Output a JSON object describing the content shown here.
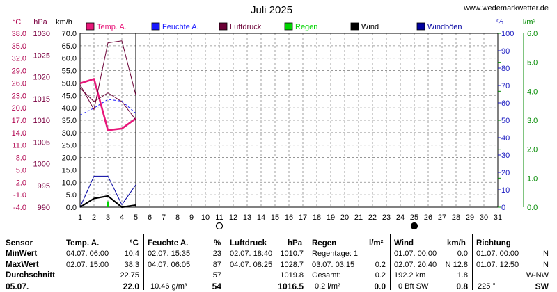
{
  "title": "Juli 2025",
  "site": "www.wedemarkwetter.de",
  "colors": {
    "temp": "#e8177a",
    "feuchte": "#1818ff",
    "luftdruck": "#6b0036",
    "regen": "#00d400",
    "wind": "#000000",
    "windboeen": "#0000a0",
    "temp_axis": "#b0004d",
    "druck_axis": "#7a0040",
    "feuchte_axis": "#1818c0",
    "regen_axis": "#008a00"
  },
  "chart_data": {
    "type": "line",
    "title": "Juli 2025",
    "x": [
      1,
      2,
      3,
      4,
      5,
      6,
      7,
      8,
      9,
      10,
      11,
      12,
      13,
      14,
      15,
      16,
      17,
      18,
      19,
      20,
      21,
      22,
      23,
      24,
      25,
      26,
      27,
      28,
      29,
      30,
      31
    ],
    "x_ticks": [
      "1",
      "2",
      "3",
      "4",
      "5",
      "6",
      "7",
      "8",
      "9",
      "10",
      "11",
      "12",
      "13",
      "14",
      "15",
      "16",
      "17",
      "18",
      "19",
      "20",
      "21",
      "22",
      "23",
      "24",
      "25",
      "26",
      "27",
      "28",
      "29",
      "30",
      "31"
    ],
    "axes": {
      "temp": {
        "unit": "°C",
        "min": -4.0,
        "max": 38.0,
        "ticks": [
          "38.0",
          "35.0",
          "32.0",
          "29.0",
          "26.0",
          "23.0",
          "20.0",
          "17.0",
          "14.0",
          "11.0",
          "8.0",
          "5.0",
          "2.0",
          "-1.0",
          "-4.0"
        ]
      },
      "druck": {
        "unit": "hPa",
        "min": 990,
        "max": 1030,
        "ticks": [
          "1030",
          "1025",
          "1020",
          "1015",
          "1010",
          "1005",
          "1000",
          "995",
          "990"
        ]
      },
      "wind": {
        "unit": "km/h",
        "min": 0.0,
        "max": 70.0,
        "ticks": [
          "70.0",
          "65.0",
          "60.0",
          "55.0",
          "50.0",
          "45.0",
          "40.0",
          "35.0",
          "30.0",
          "25.0",
          "20.0",
          "15.0",
          "10.0",
          "5.0",
          "0.0"
        ]
      },
      "feuchte": {
        "unit": "%",
        "min": 0,
        "max": 100,
        "ticks": [
          "100",
          "90",
          "80",
          "70",
          "60",
          "50",
          "40",
          "30",
          "20",
          "10",
          "0"
        ]
      },
      "regen": {
        "unit": "l/m²",
        "min": 0.0,
        "max": 6.0,
        "ticks": [
          "6.0",
          "5.0",
          "4.0",
          "3.0",
          "2.0",
          "1.0",
          "0.0"
        ]
      }
    },
    "legend": [
      {
        "key": "temp",
        "label": "Temp. A."
      },
      {
        "key": "feuchte",
        "label": "Feuchte A."
      },
      {
        "key": "luftdruck",
        "label": "Luftdruck"
      },
      {
        "key": "regen",
        "label": "Regen"
      },
      {
        "key": "wind",
        "label": "Wind"
      },
      {
        "key": "windboeen",
        "label": "Windböen"
      }
    ],
    "series": [
      {
        "key": "temp",
        "axis": "temp",
        "x": [
          1,
          2,
          3,
          4,
          5
        ],
        "values": [
          25.9,
          27.0,
          14.6,
          15.0,
          17.4
        ]
      },
      {
        "key": "temp_max",
        "axis": "temp",
        "x": [
          1,
          2,
          3,
          4,
          5
        ],
        "values": [
          25.6,
          19.6,
          35.7,
          36.2,
          23.1
        ]
      },
      {
        "key": "luftdruck",
        "axis": "druck",
        "x": [
          1,
          2,
          3,
          4,
          5
        ],
        "values": [
          1017.4,
          1014.3,
          1016.3,
          1014.3,
          1010.1
        ]
      },
      {
        "key": "feuchte",
        "axis": "feuchte",
        "x": [
          1,
          2,
          3,
          4,
          5
        ],
        "values": [
          53,
          57,
          62,
          61,
          54
        ]
      },
      {
        "key": "windboeen",
        "axis": "wind",
        "x": [
          1,
          2,
          3,
          4,
          5
        ],
        "values": [
          0.0,
          12.5,
          12.5,
          1.0,
          9.0
        ]
      },
      {
        "key": "wind",
        "axis": "wind",
        "x": [
          1,
          2,
          3,
          4,
          5
        ],
        "values": [
          0.0,
          3.5,
          4.5,
          0.0,
          0.8
        ]
      },
      {
        "key": "regen",
        "axis": "regen",
        "x": [
          3
        ],
        "values": [
          0.2
        ]
      }
    ],
    "moon": [
      {
        "day": 11,
        "phase": "full"
      },
      {
        "day": 25,
        "phase": "new"
      }
    ],
    "grid": true
  },
  "table": {
    "headers": {
      "sensor": "Sensor",
      "temp": "Temp. A.",
      "temp_unit": "°C",
      "feuchte": "Feuchte A.",
      "feuchte_unit": "%",
      "druck": "Luftdruck",
      "druck_unit": "hPa",
      "regen": "Regen",
      "regen_unit": "l/m²",
      "wind": "Wind",
      "wind_unit": "km/h",
      "richtung": "Richtung"
    },
    "rows": {
      "min": {
        "label": "MinWert",
        "temp_time": "04.07.  06:00",
        "temp_val": "10.4",
        "feuchte_time": "02.07.  15:35",
        "feuchte_val": "23",
        "druck_time": "02.07.  18:40",
        "druck_val": "1010.7",
        "regen_label": "Regentage: 1",
        "regen_val": "",
        "wind_time": "01.07.  00:00",
        "wind_val": "0.0",
        "richtung_time": "01.07.  00:00",
        "richtung_val": "N"
      },
      "max": {
        "label": "MaxWert",
        "temp_time": "02.07.  15:00",
        "temp_val": "38.3",
        "feuchte_time": "04.07.  06:05",
        "feuchte_val": "87",
        "druck_time": "04.07.  08:25",
        "druck_val": "1028.7",
        "regen_label": "03.07.  03:15",
        "regen_val": "0.2",
        "wind_time": "02.07.  20:40",
        "wind_val": "N 12.8",
        "richtung_time": "01.07.  12:50",
        "richtung_val": "N"
      },
      "avg": {
        "label": "Durchschnitt",
        "temp_val": "22.75",
        "feuchte_val": "57",
        "druck_val": "1019.8",
        "regen_label": "Gesamt:",
        "regen_val": "0.2",
        "wind_time": "192.2 km",
        "wind_val": "1.8",
        "richtung_val": "W-NW"
      },
      "current": {
        "label": "05.07.",
        "temp_val": "22.0",
        "feuchte_label": "10.46 g/m³",
        "feuchte_val": "54",
        "druck_val": "1016.5",
        "regen_label": "0.2 l/m²",
        "regen_val": "0.0",
        "wind_label": "0 Bft SW",
        "wind_val": "0.8",
        "richtung_label": "225 °",
        "richtung_val": "SW"
      }
    }
  }
}
